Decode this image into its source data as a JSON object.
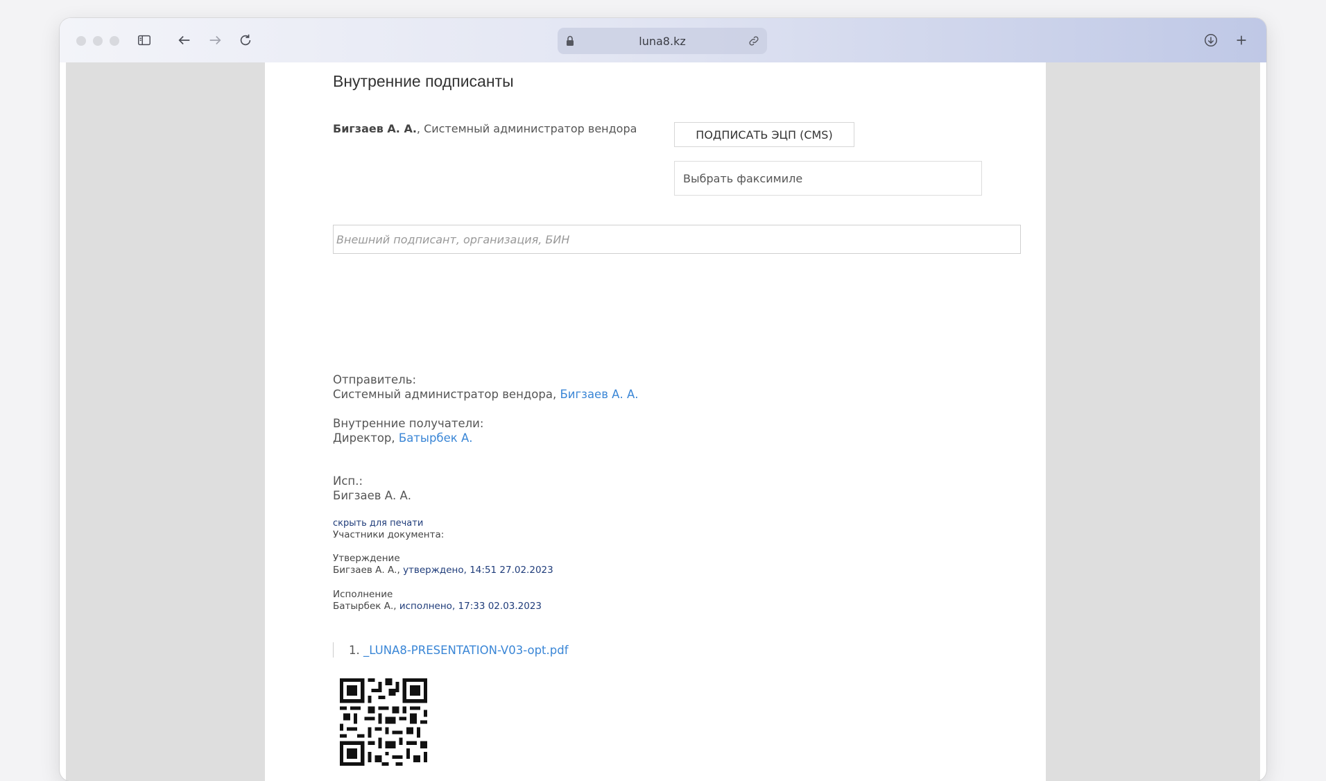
{
  "browser": {
    "url": "luna8.kz"
  },
  "signers": {
    "heading": "Внутренние подписанты",
    "signer_name": "Бигзаев А. А.",
    "signer_role": ", Системный администратор вендора",
    "sign_button": "ПОДПИСАТЬ ЭЦП (CMS)",
    "facsimile_select": "Выбрать факсимиле",
    "external_placeholder": "Внешний подписант, организация, БИН"
  },
  "sender": {
    "label": "Отправитель:",
    "role": "Системный администратор вендора, ",
    "name": "Бигзаев А. А."
  },
  "recipients": {
    "label": "Внутренние получатели:",
    "role": "Директор, ",
    "name": "Батырбек А."
  },
  "executor": {
    "label": "Исп.:",
    "name": "Бигзаев А. А."
  },
  "participants": {
    "hide_link": "скрыть для печати",
    "label": "Участники документа:",
    "approval_title": "Утверждение",
    "approval_person": "Бигзаев А. А., ",
    "approval_status": "утверждено, 14:51 27.02.2023",
    "execution_title": "Исполнение",
    "execution_person": "Батырбек А., ",
    "execution_status": "исполнено, 17:33 02.03.2023"
  },
  "attachments": {
    "index": "1.",
    "file": "_LUNA8-PRESENTATION-V03-opt.pdf"
  },
  "icons": {
    "sidebar": "sidebar-icon",
    "back": "back-arrow-icon",
    "forward": "forward-arrow-icon",
    "reload": "reload-icon",
    "lock": "lock-icon",
    "link": "link-icon",
    "download": "download-icon",
    "new_tab": "plus-icon",
    "qr": "qr-code-icon"
  },
  "colors": {
    "link": "#3a86d6",
    "dark_link": "#1f3c7a",
    "viewport_bg": "#dedede"
  }
}
